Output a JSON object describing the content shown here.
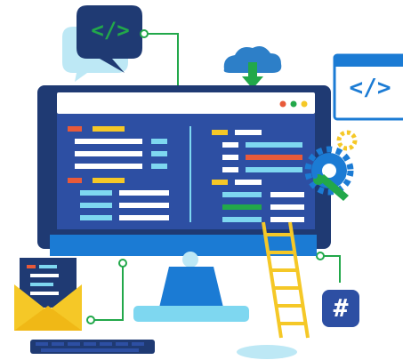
{
  "colors": {
    "navy": "#1f3a73",
    "monitor_panel": "#2d4fa3",
    "accent_blue": "#1b7bd4",
    "light_cyan": "#7ed7f0",
    "green": "#22a84a",
    "yellow": "#f5c827",
    "red": "#e85a3a",
    "white": "#ffffff"
  },
  "speech_bubble": {
    "icon": "code-tag-icon",
    "glyph": "</>"
  },
  "browser_window": {
    "icon": "code-tag-icon",
    "glyph": "</>"
  },
  "hash_badge": {
    "icon": "hash-icon",
    "glyph": "#"
  },
  "cloud": {
    "icon": "cloud-download-icon"
  },
  "settings": {
    "icon": "gear-wrench-icon"
  },
  "envelope": {
    "icon": "envelope-icon"
  },
  "ladder": {
    "icon": "ladder-icon"
  },
  "keyboard": {
    "icon": "keyboard-icon"
  },
  "window_dots": [
    "#e85a3a",
    "#22a84a",
    "#f5c827"
  ]
}
